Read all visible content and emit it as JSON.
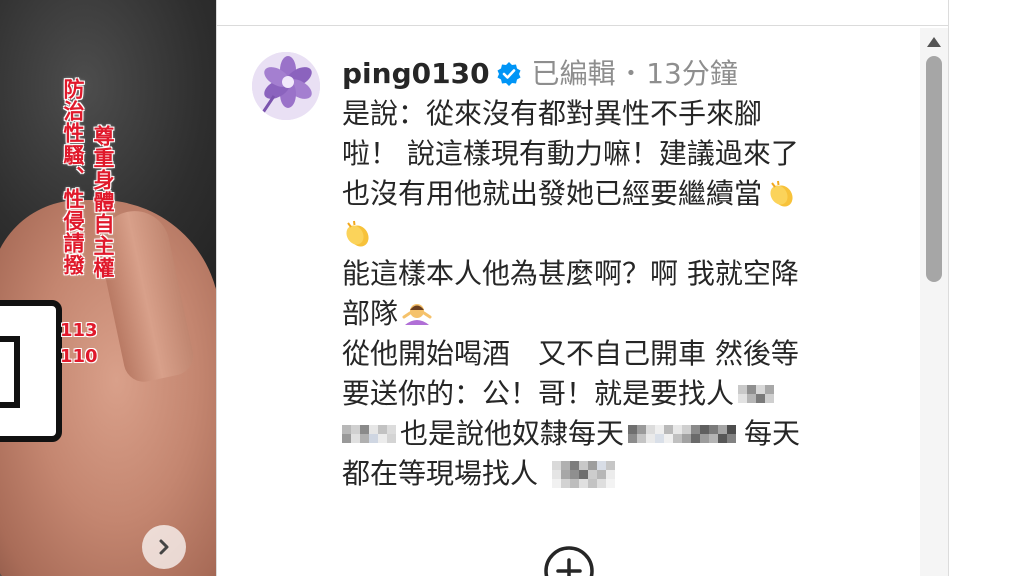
{
  "photo": {
    "overlay_right": "尊重身體自主權",
    "overlay_left": "防治性騷、性侵請撥",
    "hotline_1": "113",
    "hotline_2": "110",
    "next_icon": "chevron-right-icon",
    "overlay_color": "#e0192b"
  },
  "comment": {
    "username": "ping0130",
    "verified_icon": "verified-badge-icon",
    "verified_color": "#0095f6",
    "edited": "已編輯",
    "separator": "•",
    "time": "13分鐘",
    "lines": [
      "是說：從來沒有都對異性不手來腳",
      "啦！ 說這樣現有動力嘛！建議過來了",
      "也沒有用他就出發她已經要繼續當",
      "",
      "能這樣本人他為甚麼啊？啊 我就空降",
      "部隊",
      "從他開始喝酒　又不自己開車 然後等",
      "要送你的：公！哥！就是要找人",
      "也是說他奴隸每天",
      "每天",
      "都在等現場找人"
    ],
    "emoji_clap": "clapping-hands-emoji",
    "emoji_shrug": "person-shrugging-emoji"
  },
  "actions": {
    "add_icon": "plus-circle-icon"
  },
  "scrollbar": {
    "up_icon": "triangle-up-icon",
    "thumb_color": "#a6a6a6"
  }
}
